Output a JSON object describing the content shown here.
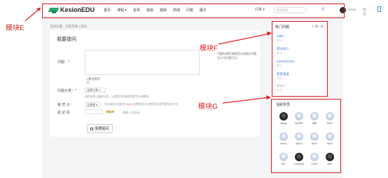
{
  "header": {
    "brand": "KesionEDU",
    "nav": [
      "首页",
      "课程 ▾",
      "名师",
      "班级",
      "题库",
      "商城",
      "问答",
      "圈子"
    ],
    "search_select": "问答 ▾",
    "search_placeholder": "快速搜索",
    "user": "wang",
    "logout": "退出"
  },
  "breadcrumb": "当前位置：问答列表 | 提问",
  "form": {
    "title": "我要提问",
    "question_label": "问题：*",
    "hint_right": "问题标题是我能提出的最好问题，怎么写好题目文？",
    "anonymous_label": "匿名提问",
    "anonymous_line2": "可",
    "category_label": "问题分类：*",
    "category_value": "选择分类 ▾",
    "category_note": "请您选择正确的分类，以使您的问题得到更专业的解答。",
    "reward_label": "悬 赏 分：",
    "reward_value": "无悬赏 ▾",
    "reward_note_pre": "您当前的可用积分",
    "reward_points": "4520",
    "reward_note_post": "设置悬赏可以使您的问题受更多的关注",
    "captcha_label": "验 证 码",
    "captcha_image": "a6pA",
    "captcha_hint": "请输入验证码",
    "submit": "我要提问"
  },
  "hot": {
    "title": "热门问题",
    "refresh": "换一批",
    "items": [
      {
        "title": "fadsf",
        "sub": "句 0"
      },
      {
        "title": "得分多少",
        "sub": "句 0"
      },
      {
        "title": "4444444444",
        "sub": "句 0"
      },
      {
        "title": "反反复复",
        "sub": "句 0"
      },
      {
        "title": "什么？",
        "sub": "句 0"
      }
    ]
  },
  "students": {
    "title": "活跃学员",
    "list": [
      "wang",
      "QWER",
      "tttttt",
      "bb22",
      "ces11",
      "ukh11",
      "bb11",
      "ee11",
      "ff11",
      "ruopeak",
      "11111",
      "liuin"
    ]
  },
  "annotations": {
    "e": "模块E",
    "f": "模块F",
    "g": "模块G",
    "color": "#e02020"
  }
}
